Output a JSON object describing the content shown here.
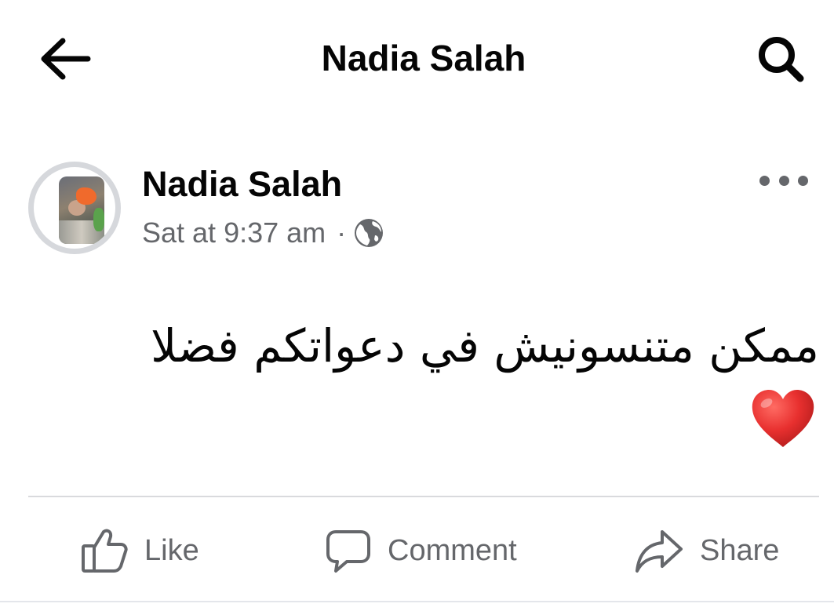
{
  "header": {
    "title": "Nadia Salah",
    "back_icon": "arrow-left-icon",
    "search_icon": "search-icon"
  },
  "post": {
    "author": "Nadia Salah",
    "timestamp": "Sat at 9:37 am",
    "separator": "·",
    "audience_icon": "globe-icon",
    "more_icon": "more-horizontal-icon",
    "text": "ممكن متنسونيش في دعواتكم فضلا",
    "emoji": "heart-icon",
    "heart_color": "#e8302f"
  },
  "actions": {
    "like_label": "Like",
    "comment_label": "Comment",
    "share_label": "Share"
  },
  "colors": {
    "text_primary": "#050505",
    "text_secondary": "#65676b",
    "divider": "#d9dadd"
  }
}
